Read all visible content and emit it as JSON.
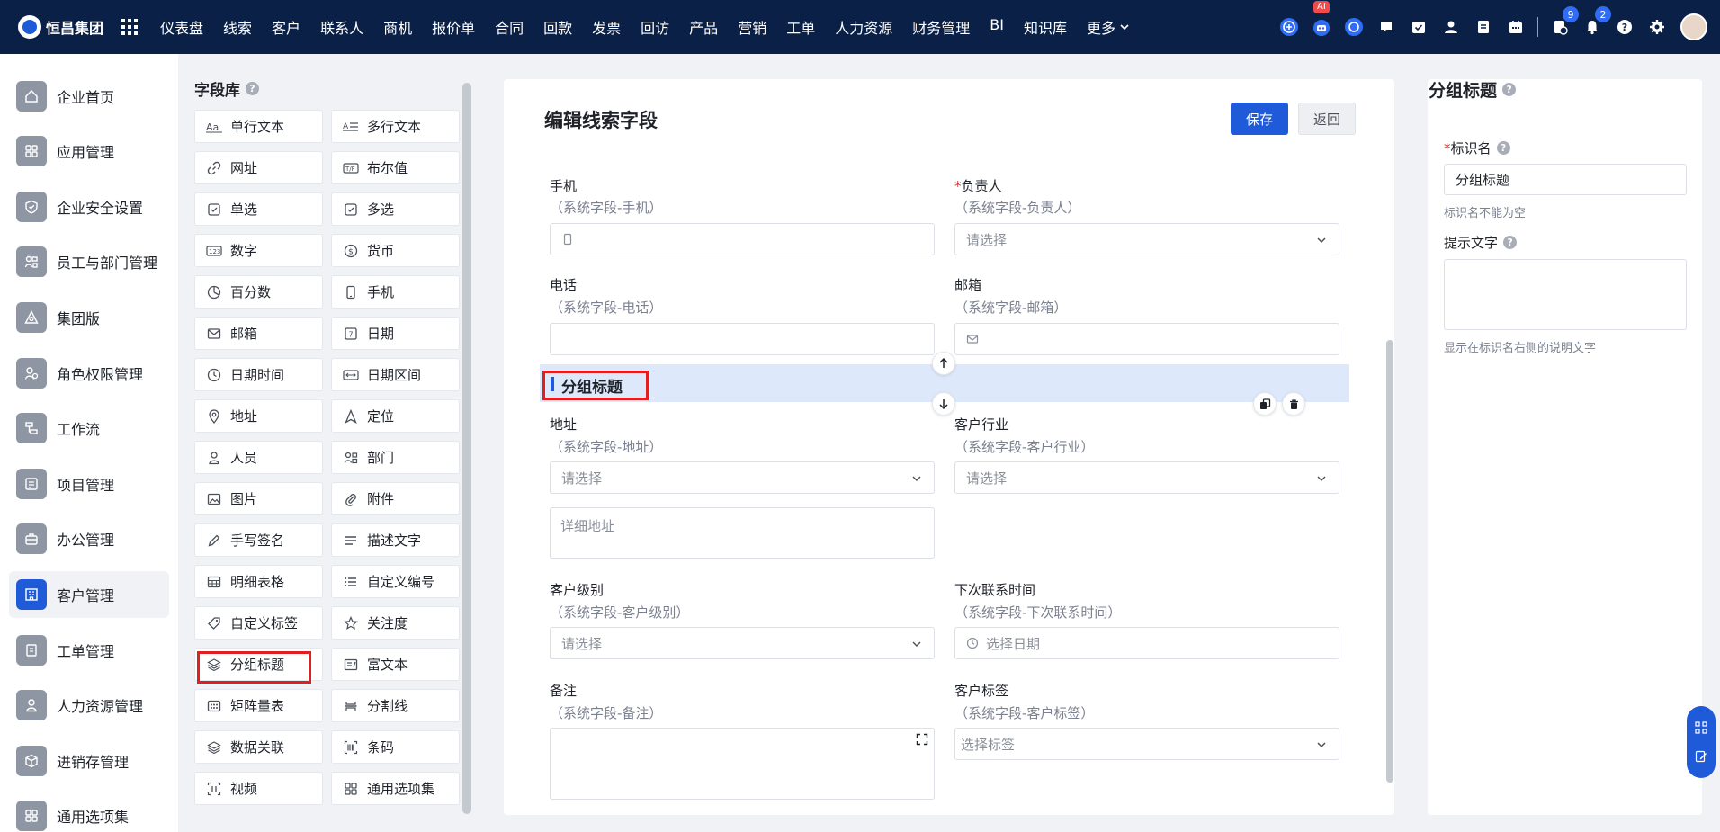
{
  "app": {
    "logo_text": "恒昌集团",
    "nav": [
      "仪表盘",
      "线索",
      "客户",
      "联系人",
      "商机",
      "报价单",
      "合同",
      "回款",
      "发票",
      "回访",
      "产品",
      "营销",
      "工单",
      "人力资源",
      "财务管理",
      "BI",
      "知识库"
    ],
    "nav_more": "更多",
    "ai_badge": "AI",
    "notification_count_1": "9",
    "notification_count_2": "2",
    "accent_color": "#1f5bd8",
    "topbar_color": "#0b2046"
  },
  "sidebar": {
    "items": [
      {
        "label": "企业首页",
        "icon": "home-icon"
      },
      {
        "label": "应用管理",
        "icon": "apps-icon"
      },
      {
        "label": "企业安全设置",
        "icon": "shield-icon"
      },
      {
        "label": "员工与部门管理",
        "icon": "org-icon"
      },
      {
        "label": "集团版",
        "icon": "group-icon"
      },
      {
        "label": "角色权限管理",
        "icon": "role-icon"
      },
      {
        "label": "工作流",
        "icon": "workflow-icon"
      },
      {
        "label": "项目管理",
        "icon": "project-icon"
      },
      {
        "label": "办公管理",
        "icon": "office-icon"
      },
      {
        "label": "客户管理",
        "icon": "customer-icon"
      },
      {
        "label": "工单管理",
        "icon": "ticket-icon"
      },
      {
        "label": "人力资源管理",
        "icon": "hr-icon"
      },
      {
        "label": "进销存管理",
        "icon": "inventory-icon"
      },
      {
        "label": "通用选项集",
        "icon": "options-icon"
      }
    ],
    "active_index": 9
  },
  "library": {
    "title": "字段库",
    "items": [
      [
        "单行文本",
        "多行文本"
      ],
      [
        "网址",
        "布尔值"
      ],
      [
        "单选",
        "多选"
      ],
      [
        "数字",
        "货币"
      ],
      [
        "百分数",
        "手机"
      ],
      [
        "邮箱",
        "日期"
      ],
      [
        "日期时间",
        "日期区间"
      ],
      [
        "地址",
        "定位"
      ],
      [
        "人员",
        "部门"
      ],
      [
        "图片",
        "附件"
      ],
      [
        "手写签名",
        "描述文字"
      ],
      [
        "明细表格",
        "自定义编号"
      ],
      [
        "自定义标签",
        "关注度"
      ],
      [
        "分组标题",
        "富文本"
      ],
      [
        "矩阵量表",
        "分割线"
      ],
      [
        "数据关联",
        "条码"
      ],
      [
        "视频",
        "通用选项集"
      ]
    ]
  },
  "editor": {
    "title": "编辑线索字段",
    "save": "保存",
    "back": "返回",
    "fields": {
      "mobile": {
        "label": "手机",
        "sub": "（系统字段-手机）"
      },
      "owner": {
        "label": "负责人",
        "sub": "（系统字段-负责人）",
        "placeholder": "请选择"
      },
      "phone": {
        "label": "电话",
        "sub": "（系统字段-电话）"
      },
      "email": {
        "label": "邮箱",
        "sub": "（系统字段-邮箱）"
      },
      "address": {
        "label": "地址",
        "sub": "（系统字段-地址）",
        "placeholder": "请选择",
        "detail_placeholder": "详细地址"
      },
      "industry": {
        "label": "客户行业",
        "sub": "（系统字段-客户行业）",
        "placeholder": "请选择"
      },
      "level": {
        "label": "客户级别",
        "sub": "（系统字段-客户级别）",
        "placeholder": "请选择"
      },
      "next_contact": {
        "label": "下次联系时间",
        "sub": "（系统字段-下次联系时间）",
        "placeholder": "选择日期"
      },
      "remark": {
        "label": "备注",
        "sub": "（系统字段-备注）"
      },
      "tags": {
        "label": "客户标签",
        "sub": "（系统字段-客户标签）",
        "placeholder": "选择标签"
      }
    },
    "group_title": "分组标题"
  },
  "props": {
    "title": "分组标题",
    "name_label": "标识名",
    "name_value": "分组标题",
    "name_help": "标识名不能为空",
    "hint_label": "提示文字",
    "hint_help": "显示在标识名右侧的说明文字"
  }
}
